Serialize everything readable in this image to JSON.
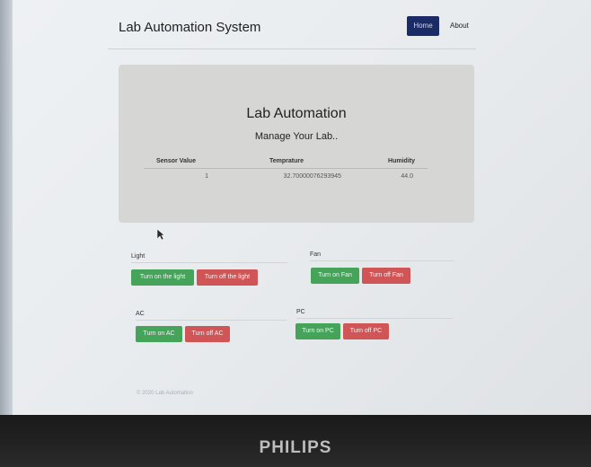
{
  "navbar": {
    "title": "Lab Automation System",
    "links": [
      {
        "label": "Home",
        "active": true
      },
      {
        "label": "About",
        "active": false
      }
    ]
  },
  "jumbotron": {
    "title": "Lab Automation",
    "subtitle": "Manage Your Lab..",
    "table": {
      "headers": [
        "Sensor Value",
        "Temprature",
        "Humidity"
      ],
      "rows": [
        [
          "1",
          "32.70000076293945",
          "44.0"
        ]
      ]
    }
  },
  "controls": {
    "light": {
      "label": "Light",
      "on_label": "Turn on the light",
      "off_label": "Turn off the light"
    },
    "fan": {
      "label": "Fan",
      "on_label": "Turn on Fan",
      "off_label": "Turn off Fan"
    },
    "ac": {
      "label": "AC",
      "on_label": "Turn on AC",
      "off_label": "Turn off AC"
    },
    "pc": {
      "label": "PC",
      "on_label": "Turn on PC",
      "off_label": "Turn off PC"
    }
  },
  "footer": {
    "text": "© 2020 Lab Automation"
  },
  "monitor": {
    "brand": "PHILIPS"
  },
  "colors": {
    "nav_active": "#1b2b66",
    "on_button": "#46a35a",
    "off_button": "#cf5556",
    "jumbotron_bg": "#d6d7d5"
  }
}
